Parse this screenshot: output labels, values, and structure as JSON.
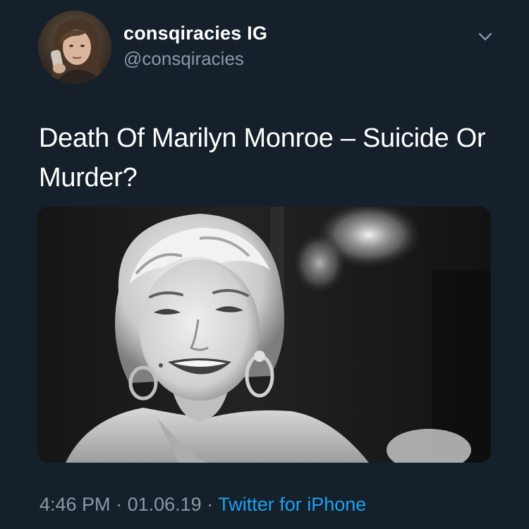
{
  "tweet": {
    "display_name": "consqiracies IG",
    "handle": "@consqiracies",
    "text": "Death Of Marilyn Monroe – Suicide Or Murder?",
    "time": "4:46 PM",
    "separator": "·",
    "date": "01.06.19",
    "source": "Twitter for iPhone"
  },
  "icons": {
    "menu": "chevron-down-icon",
    "avatar": "profile-avatar"
  },
  "colors": {
    "background": "#15202b",
    "primary_text": "#ffffff",
    "secondary_text": "#8899a6",
    "link": "#1da1f2"
  }
}
